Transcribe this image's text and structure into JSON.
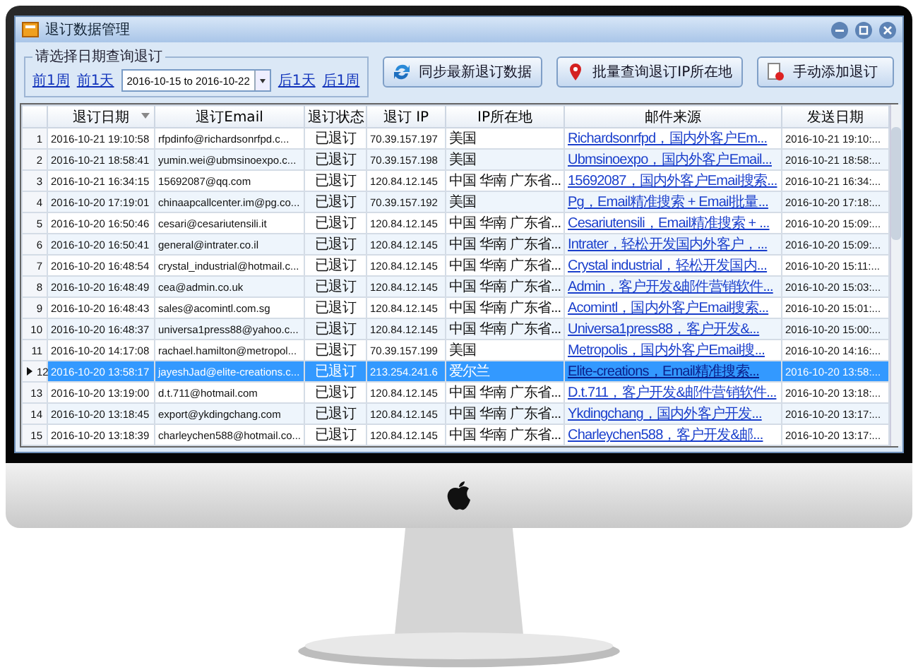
{
  "window": {
    "title": "退订数据管理"
  },
  "date_filter": {
    "legend": "请选择日期查询退订",
    "links_before": [
      "前1周",
      "前1天"
    ],
    "range": "2016-10-15 to 2016-10-22",
    "links_after": [
      "后1天",
      "后1周"
    ]
  },
  "buttons": [
    {
      "label": "同步最新退订数据",
      "kind": "sync"
    },
    {
      "label": "批量查询退订IP所在地",
      "kind": "locate"
    },
    {
      "label": "手动添加退订",
      "kind": "add"
    }
  ],
  "table": {
    "columns": [
      {
        "label": "退订日期",
        "sorted": true
      },
      {
        "label": "退订Email",
        "sorted": false
      },
      {
        "label": "退订状态",
        "sorted": false
      },
      {
        "label": "退订 IP",
        "sorted": false
      },
      {
        "label": "IP所在地",
        "sorted": false
      },
      {
        "label": "邮件来源",
        "sorted": false
      },
      {
        "label": "发送日期",
        "sorted": false
      }
    ],
    "rows": [
      {
        "number": "1",
        "selected": false,
        "cells": [
          "2016-10-21 19:10:58",
          "rfpdinfo@richardsonrfpd.c...",
          "已退订",
          "70.39.157.197",
          "美国",
          "Richardsonrfpd，国内外客户Em...",
          "2016-10-21 19:10:..."
        ]
      },
      {
        "number": "2",
        "selected": false,
        "cells": [
          "2016-10-21 18:58:41",
          "yumin.wei@ubmsinoexpo.c...",
          "已退订",
          "70.39.157.198",
          "美国",
          "Ubmsinoexpo，国内外客户Email...",
          "2016-10-21 18:58:..."
        ]
      },
      {
        "number": "3",
        "selected": false,
        "cells": [
          "2016-10-21 16:34:15",
          "15692087@qq.com",
          "已退订",
          "120.84.12.145",
          "中国 华南 广东省...",
          "15692087，国内外客户Email搜索...",
          "2016-10-21 16:34:..."
        ]
      },
      {
        "number": "4",
        "selected": false,
        "cells": [
          "2016-10-20 17:19:01",
          "chinaapcallcenter.im@pg.co...",
          "已退订",
          "70.39.157.192",
          "美国",
          "Pg，Email精准搜索 + Email批量...",
          "2016-10-20 17:18:..."
        ]
      },
      {
        "number": "5",
        "selected": false,
        "cells": [
          "2016-10-20 16:50:46",
          "cesari@cesariutensili.it",
          "已退订",
          "120.84.12.145",
          "中国 华南 广东省...",
          "Cesariutensili，Email精准搜索 + ...",
          "2016-10-20 15:09:..."
        ]
      },
      {
        "number": "6",
        "selected": false,
        "cells": [
          "2016-10-20 16:50:41",
          "general@intrater.co.il",
          "已退订",
          "120.84.12.145",
          "中国 华南 广东省...",
          "Intrater，轻松开发国内外客户，...",
          "2016-10-20 15:09:..."
        ]
      },
      {
        "number": "7",
        "selected": false,
        "cells": [
          "2016-10-20 16:48:54",
          "crystal_industrial@hotmail.c...",
          "已退订",
          "120.84.12.145",
          "中国 华南 广东省...",
          "Crystal industrial，轻松开发国内...",
          "2016-10-20 15:11:..."
        ]
      },
      {
        "number": "8",
        "selected": false,
        "cells": [
          "2016-10-20 16:48:49",
          "cea@admin.co.uk",
          "已退订",
          "120.84.12.145",
          "中国 华南 广东省...",
          "Admin，客户开发&邮件营销软件...",
          "2016-10-20 15:03:..."
        ]
      },
      {
        "number": "9",
        "selected": false,
        "cells": [
          "2016-10-20 16:48:43",
          "sales@acomintl.com.sg",
          "已退订",
          "120.84.12.145",
          "中国 华南 广东省...",
          "Acomintl，国内外客户Email搜索...",
          "2016-10-20 15:01:..."
        ]
      },
      {
        "number": "10",
        "selected": false,
        "cells": [
          "2016-10-20 16:48:37",
          "universa1press88@yahoo.c...",
          "已退订",
          "120.84.12.145",
          "中国 华南 广东省...",
          "Universa1press88，客户开发&...",
          "2016-10-20 15:00:..."
        ]
      },
      {
        "number": "11",
        "selected": false,
        "cells": [
          "2016-10-20 14:17:08",
          "rachael.hamilton@metropol...",
          "已退订",
          "70.39.157.199",
          "美国",
          "Metropolis，国内外客户Email搜...",
          "2016-10-20 14:16:..."
        ]
      },
      {
        "number": "12",
        "selected": true,
        "cells": [
          "2016-10-20 13:58:17",
          "jayeshJad@elite-creations.c...",
          "已退订",
          "213.254.241.6",
          "爱尔兰",
          "Elite-creations，Email精准搜索...",
          "2016-10-20 13:58:..."
        ]
      },
      {
        "number": "13",
        "selected": false,
        "cells": [
          "2016-10-20 13:19:00",
          "d.t.711@hotmail.com",
          "已退订",
          "120.84.12.145",
          "中国 华南 广东省...",
          "D.t.711，客户开发&邮件营销软件...",
          "2016-10-20 13:18:..."
        ]
      },
      {
        "number": "14",
        "selected": false,
        "cells": [
          "2016-10-20 13:18:45",
          "export@ykdingchang.com",
          "已退订",
          "120.84.12.145",
          "中国 华南 广东省...",
          "Ykdingchang，国内外客户开发...",
          "2016-10-20 13:17:..."
        ]
      },
      {
        "number": "15",
        "selected": false,
        "cells": [
          "2016-10-20 13:18:39",
          "charleychen588@hotmail.co...",
          "已退订",
          "120.84.12.145",
          "中国 华南 广东省...",
          "Charleychen588，客户开发&邮...",
          "2016-10-20 13:17:..."
        ]
      }
    ]
  }
}
